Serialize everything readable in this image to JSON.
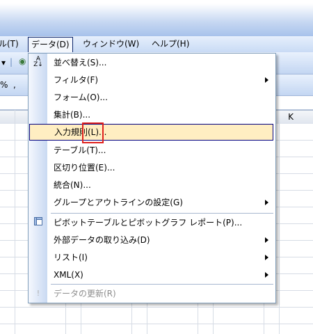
{
  "menubar": {
    "items": [
      {
        "label": "ル(T)"
      },
      {
        "label": "データ(D)"
      },
      {
        "label": "ウィンドウ(W)"
      },
      {
        "label": "ヘルプ(H)"
      }
    ]
  },
  "toolbar": {
    "row2_symbols": "%  ,"
  },
  "grid": {
    "visible_column": "K"
  },
  "data_menu": {
    "items": [
      {
        "label": "並べ替え(S)...",
        "icon": "sort-az-icon"
      },
      {
        "label": "フィルタ(F)",
        "submenu": true
      },
      {
        "label": "フォーム(O)..."
      },
      {
        "label": "集計(B)..."
      },
      {
        "label": "入力規則(L)...",
        "highlighted": true
      },
      {
        "label": "テーブル(T)..."
      },
      {
        "label": "区切り位置(E)..."
      },
      {
        "label": "統合(N)..."
      },
      {
        "label": "グループとアウトラインの設定(G)",
        "submenu": true
      },
      {
        "label": "ピボットテーブルとピボットグラフ レポート(P)...",
        "icon": "pivot-table-icon"
      },
      {
        "label": "外部データの取り込み(D)",
        "submenu": true
      },
      {
        "label": "リスト(I)",
        "submenu": true
      },
      {
        "label": "XML(X)",
        "submenu": true
      },
      {
        "label": "データの更新(R)",
        "disabled": true,
        "icon": "refresh-icon"
      }
    ]
  },
  "annotation": {
    "color": "#e0201c",
    "target": "入力規則(L)"
  }
}
